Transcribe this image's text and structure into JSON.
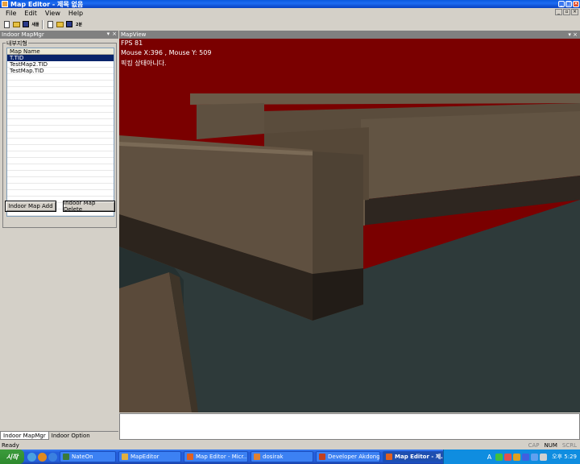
{
  "window": {
    "title": "Map Editor - 제목 없음",
    "minimize": "_",
    "maximize": "□",
    "close": "×"
  },
  "menu": {
    "items": [
      {
        "label": "File"
      },
      {
        "label": "Edit"
      },
      {
        "label": "View"
      },
      {
        "label": "Help"
      }
    ]
  },
  "toolbar": {
    "buttons": [
      "new",
      "open",
      "save",
      "새폴",
      "new",
      "open",
      "save",
      "2분"
    ]
  },
  "left_panel": {
    "caption": "Indoor MapMgr",
    "caption_pin": "▾",
    "caption_close": "×",
    "group_title": "내부지형",
    "list": {
      "header": "Map Name",
      "rows": [
        "T.TID",
        "TestMap2.TID",
        "TestMap.TID"
      ],
      "selected_index": 0
    },
    "add_button": "Indoor Map Add",
    "delete_button": "Indoor Map Delete",
    "tabs": [
      "Indoor MapMgr",
      "Indoor Option"
    ],
    "active_tab": 0
  },
  "map_view": {
    "caption": "MapView",
    "caption_buttons": "▾ ×",
    "fps": "FPS 81",
    "mouse": "Mouse X:396 , Mouse Y: 509",
    "status_msg": "픽킹 상태아니다."
  },
  "statusbar": {
    "text": "Ready",
    "cap": "CAP",
    "num": "NUM",
    "scrl": "SCRL"
  },
  "taskbar": {
    "start": "시작",
    "tasks": [
      {
        "label": "NateOn",
        "color": "#3a7a3a"
      },
      {
        "label": "MapEditor",
        "color": "#e0b040"
      },
      {
        "label": "Map Editor - Micr...",
        "color": "#e06020"
      },
      {
        "label": "dosirak",
        "color": "#e08030"
      },
      {
        "label": "Developer Akdong...",
        "color": "#c04020"
      },
      {
        "label": "Map Editor - 제...",
        "color": "#e06020"
      }
    ],
    "active_task": 5,
    "lang": "A",
    "clock": "오후 5:29"
  },
  "colors": {
    "sky": "#7a0000",
    "wall": "#5a4a3a",
    "floor": "#2e3a3a"
  }
}
